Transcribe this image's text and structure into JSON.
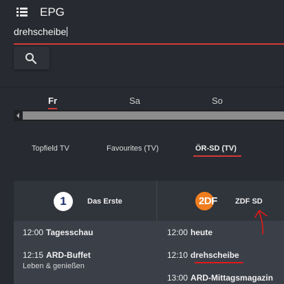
{
  "header": {
    "title": "EPG",
    "menu_icon": "hamburger-menu-icon"
  },
  "search": {
    "value": "drehscheibe",
    "button_icon": "search-icon",
    "accent": "#d43a3a"
  },
  "days": [
    {
      "label": "Fr",
      "active": true
    },
    {
      "label": "Sa",
      "active": false
    },
    {
      "label": "So",
      "active": false
    }
  ],
  "lists": [
    {
      "label": "Topfield TV",
      "active": false
    },
    {
      "label": "Favourites (TV)",
      "active": false
    },
    {
      "label": "ÖR-SD (TV)",
      "active": true
    }
  ],
  "channels": [
    {
      "name": "Das Erste",
      "logo": "1",
      "programs": [
        {
          "time": "12:00",
          "title": "Tagesschau"
        },
        {
          "time": "12:15",
          "title": "ARD-Buffet",
          "subtitle": "Leben & genießen"
        }
      ]
    },
    {
      "name": "ZDF SD",
      "logo": "2DF",
      "programs": [
        {
          "time": "12:00",
          "title": "heute"
        },
        {
          "time": "12:10",
          "title": "drehscheibe"
        },
        {
          "time": "13:00",
          "title": "ARD-Mittagsmagazin"
        }
      ]
    }
  ]
}
